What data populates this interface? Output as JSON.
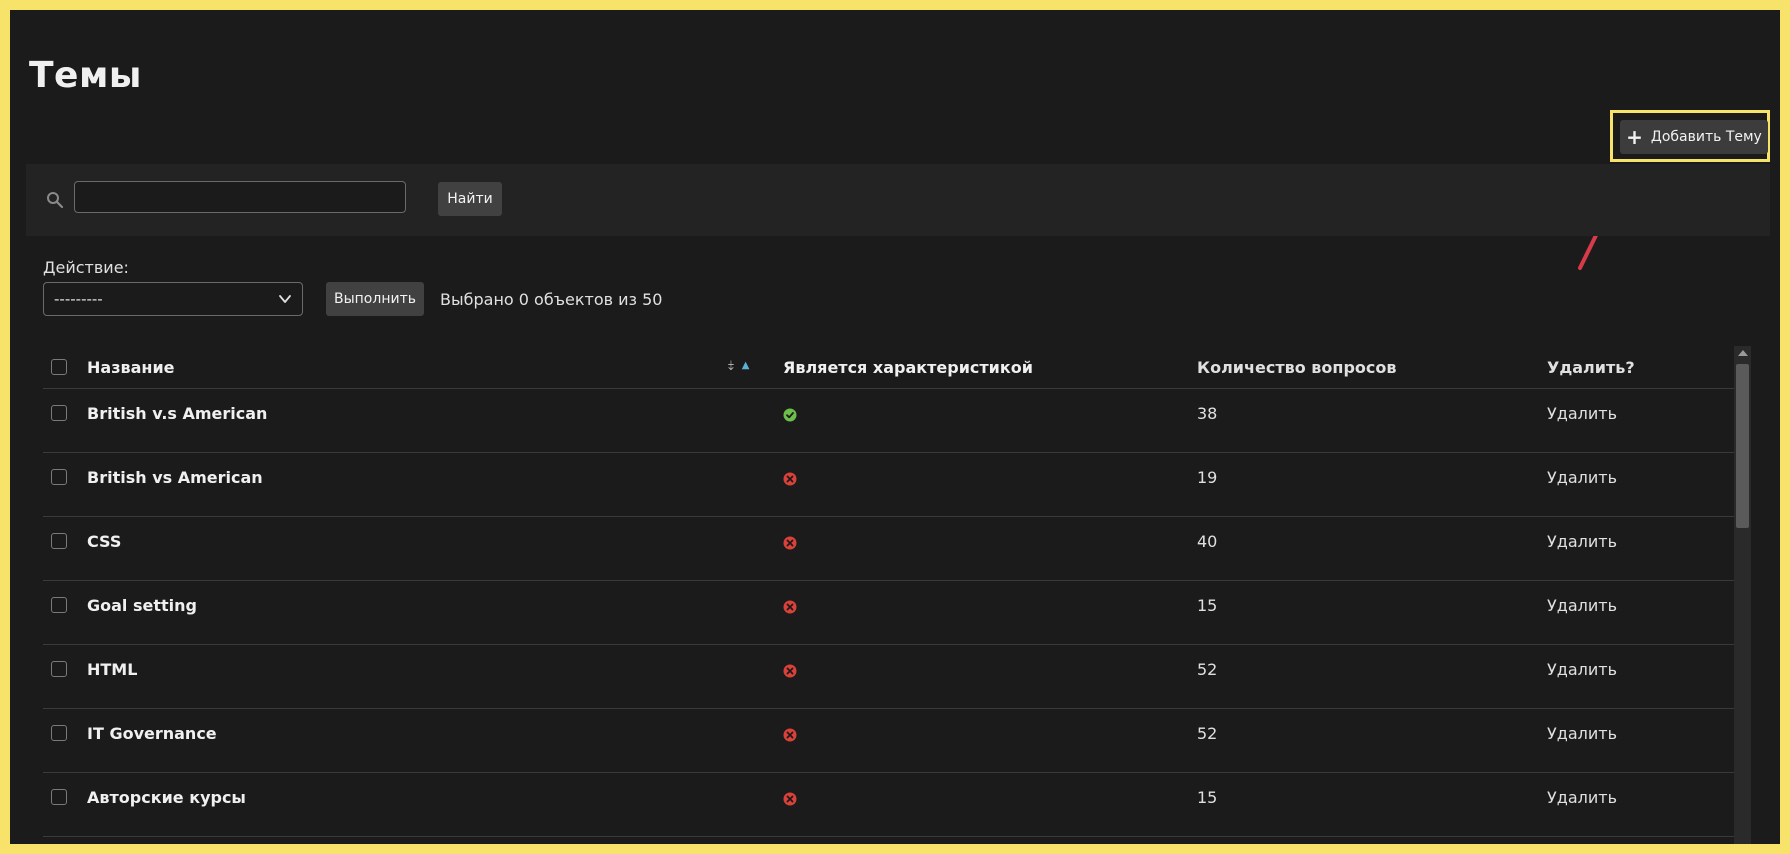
{
  "page": {
    "title": "Темы"
  },
  "add_button": {
    "label": "Добавить Тему",
    "icon": "plus-icon"
  },
  "search": {
    "placeholder": "",
    "value": "",
    "button_label": "Найти"
  },
  "action": {
    "label": "Действие:",
    "selected": "---------",
    "run_label": "Выполнить",
    "counter": "Выбрано 0 объектов из 50"
  },
  "table": {
    "headers": {
      "name": "Название",
      "is_characteristic": "Является характеристикой",
      "question_count": "Количество вопросов",
      "delete": "Удалить?"
    },
    "rows": [
      {
        "name": "British v.s American",
        "is_characteristic": true,
        "count": "38",
        "delete": "Удалить"
      },
      {
        "name": "British vs American",
        "is_characteristic": false,
        "count": "19",
        "delete": "Удалить"
      },
      {
        "name": "CSS",
        "is_characteristic": false,
        "count": "40",
        "delete": "Удалить"
      },
      {
        "name": "Goal setting",
        "is_characteristic": false,
        "count": "15",
        "delete": "Удалить"
      },
      {
        "name": "HTML",
        "is_characteristic": false,
        "count": "52",
        "delete": "Удалить"
      },
      {
        "name": "IT Governance",
        "is_characteristic": false,
        "count": "52",
        "delete": "Удалить"
      },
      {
        "name": "Авторские курсы",
        "is_characteristic": false,
        "count": "15",
        "delete": "Удалить"
      }
    ]
  },
  "colors": {
    "frame_border": "#f7e36a",
    "background": "#1b1b1b",
    "yes": "#6cc04a",
    "no": "#d9413a",
    "annotation_arrow": "#d93a4a"
  }
}
